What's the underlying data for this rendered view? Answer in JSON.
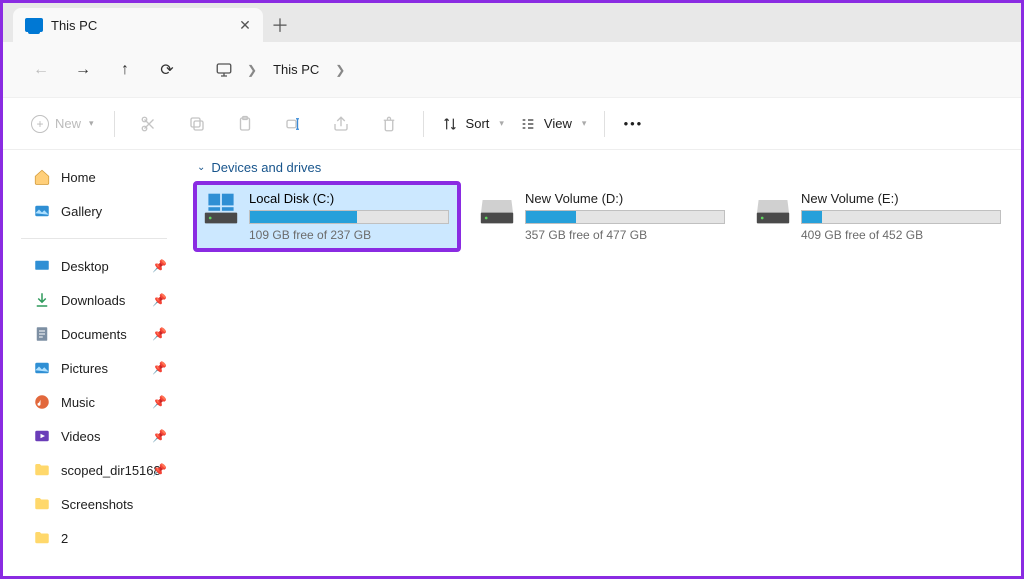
{
  "tab": {
    "title": "This PC"
  },
  "address": {
    "location": "This PC"
  },
  "toolbar": {
    "new_label": "New",
    "sort_label": "Sort",
    "view_label": "View"
  },
  "sidebar": {
    "top": [
      {
        "label": "Home"
      },
      {
        "label": "Gallery"
      }
    ],
    "quick": [
      {
        "label": "Desktop",
        "pinned": true
      },
      {
        "label": "Downloads",
        "pinned": true
      },
      {
        "label": "Documents",
        "pinned": true
      },
      {
        "label": "Pictures",
        "pinned": true
      },
      {
        "label": "Music",
        "pinned": true
      },
      {
        "label": "Videos",
        "pinned": true
      },
      {
        "label": "scoped_dir15168",
        "pinned": true
      },
      {
        "label": "Screenshots",
        "pinned": false
      },
      {
        "label": "2",
        "pinned": false
      }
    ]
  },
  "main": {
    "group_label": "Devices and drives",
    "drives": [
      {
        "name": "Local Disk (C:)",
        "free_text": "109 GB free of 237 GB",
        "fill_pct": 54,
        "selected": true,
        "highlighted": true,
        "kind": "os"
      },
      {
        "name": "New Volume (D:)",
        "free_text": "357 GB free of 477 GB",
        "fill_pct": 25,
        "selected": false,
        "highlighted": false,
        "kind": "hdd"
      },
      {
        "name": "New Volume (E:)",
        "free_text": "409 GB free of 452 GB",
        "fill_pct": 10,
        "selected": false,
        "highlighted": false,
        "kind": "hdd"
      }
    ]
  }
}
